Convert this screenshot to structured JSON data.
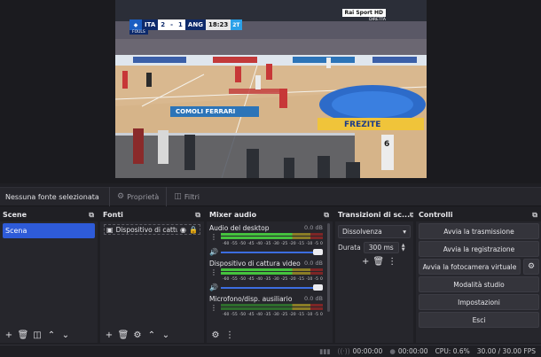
{
  "preview": {
    "scorebug": {
      "team1": "ITA",
      "score1": "2",
      "score2": "1",
      "team2": "ANG",
      "clock": "18:23",
      "period": "2T",
      "sub": "FOULS"
    },
    "broadcaster": "Rai Sport HD",
    "broadcaster_sub": "DIRETTA",
    "banner1": "COMOLI FERRARI",
    "banner2": "FREZITE",
    "player_number": "6"
  },
  "source_bar": {
    "no_source": "Nessuna fonte selezionata",
    "properties_label": "Proprietà",
    "filters_label": "Filtri"
  },
  "scene_dock": {
    "title": "Scene",
    "items": [
      "Scena"
    ]
  },
  "sources_dock": {
    "title": "Fonti",
    "items": [
      {
        "label": "Dispositivo di cattu",
        "icon": "camera-icon"
      }
    ]
  },
  "mixer_dock": {
    "title": "Mixer audio",
    "channels": [
      {
        "name": "Audio del desktop",
        "db": "0.0 dB"
      },
      {
        "name": "Dispositivo di cattura video",
        "db": "0.0 dB"
      },
      {
        "name": "Microfono/disp. ausiliario",
        "db": "0.0 dB"
      }
    ],
    "ticks": [
      "-60",
      "-55",
      "-50",
      "-45",
      "-40",
      "-35",
      "-30",
      "-25",
      "-20",
      "-15",
      "-10",
      "-5",
      "0"
    ]
  },
  "transitions_dock": {
    "title": "Transizioni di sc...",
    "selected": "Dissolvenza",
    "duration_label": "Durata",
    "duration_value": "300 ms"
  },
  "controls_dock": {
    "title": "Controlli",
    "start_stream": "Avvia la trasmissione",
    "start_recording": "Avvia la registrazione",
    "start_virtual_cam": "Avvia la fotocamera virtuale",
    "studio_mode": "Modalità studio",
    "settings": "Impostazioni",
    "exit": "Esci"
  },
  "status_bar": {
    "stream_time": "00:00:00",
    "record_time": "00:00:00",
    "cpu": "CPU: 0.6%",
    "fps": "30.00 / 30.00 FPS"
  },
  "colors": {
    "accent": "#2e5bd8",
    "meter_green": "#45c23e",
    "meter_yellow": "#8a7d26",
    "meter_red": "#7d2626"
  }
}
